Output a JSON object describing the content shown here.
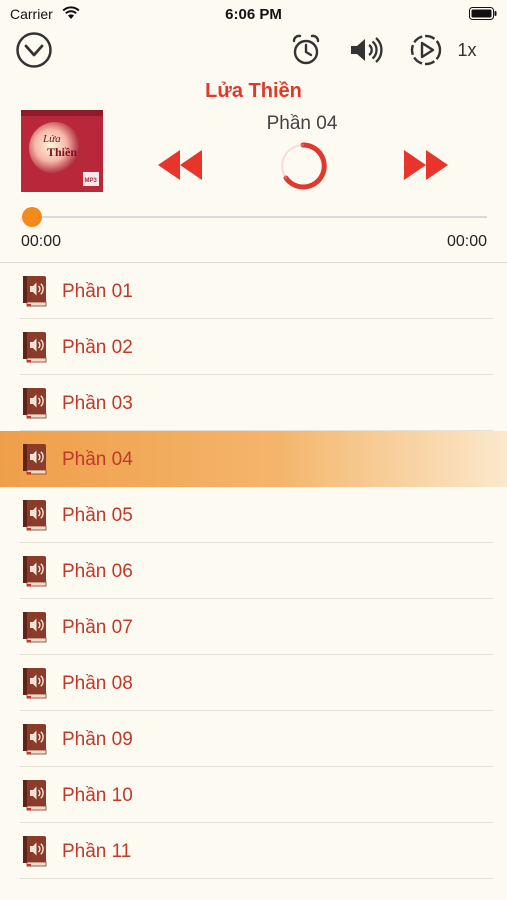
{
  "status_bar": {
    "carrier": "Carrier",
    "time": "6:06 PM"
  },
  "toolbar": {
    "speed_label": "1x"
  },
  "player": {
    "title": "Lửa Thiền",
    "current_track": "Phần 04",
    "elapsed": "00:00",
    "duration": "00:00",
    "progress_fraction": 0,
    "accent_color": "#e0382c",
    "highlight_color": "#ef9f4a"
  },
  "cover": {
    "title_line1": "Lửa",
    "title_line2": "Thiền",
    "badge": "MP3"
  },
  "tracks": [
    {
      "label": "Phần 01"
    },
    {
      "label": "Phần 02"
    },
    {
      "label": "Phần 03"
    },
    {
      "label": "Phần 04",
      "active": true
    },
    {
      "label": "Phần 05"
    },
    {
      "label": "Phần 06"
    },
    {
      "label": "Phần 07"
    },
    {
      "label": "Phần 08"
    },
    {
      "label": "Phần 09"
    },
    {
      "label": "Phần 10"
    },
    {
      "label": "Phần 11"
    }
  ],
  "icons": {
    "collapse": "chevron-down-circle-icon",
    "timer": "alarm-clock-icon",
    "volume": "speaker-icon",
    "autoplay": "play-circle-dashed-icon",
    "rewind": "rewind-icon",
    "forward": "fast-forward-icon",
    "loading": "loading-spinner-icon",
    "track": "audio-book-icon"
  }
}
